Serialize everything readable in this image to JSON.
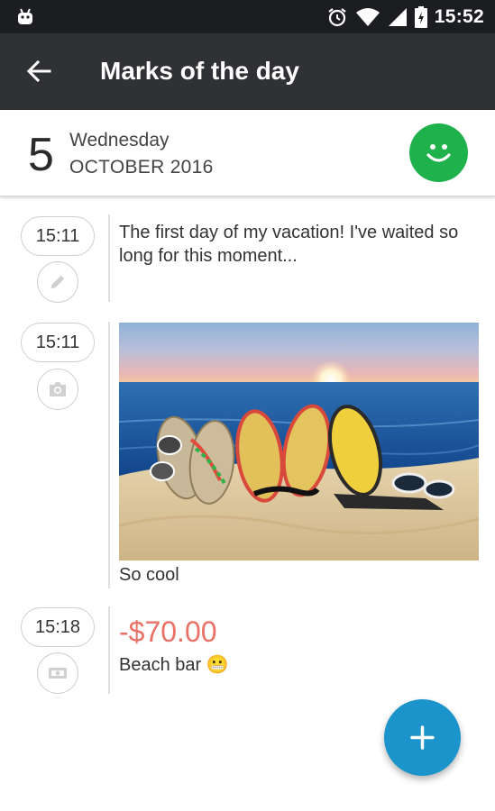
{
  "status_bar": {
    "time": "15:52",
    "icons": [
      "android-icon",
      "alarm-icon",
      "wifi-icon",
      "signal-icon",
      "battery-charging-icon"
    ]
  },
  "app_bar": {
    "title": "Marks of the day",
    "back_icon": "arrow-back-icon"
  },
  "date_header": {
    "day": "5",
    "weekday": "Wednesday",
    "month_year": "OCTOBER 2016",
    "mood_icon": "smiley-icon",
    "mood_color": "#1fb14b"
  },
  "entries": [
    {
      "time": "15:11",
      "type_icon": "pencil-icon",
      "text": "The first day of my vacation! I've waited so long for this moment..."
    },
    {
      "time": "15:11",
      "type_icon": "camera-icon",
      "image": "beach-sandals-photo",
      "caption": "So cool"
    },
    {
      "time": "15:18",
      "type_icon": "money-icon",
      "amount": "-$70.00",
      "amount_color": "#ea7167",
      "note": "Beach bar 😬"
    }
  ],
  "fab": {
    "icon": "plus-icon",
    "color": "#1b93cb"
  }
}
